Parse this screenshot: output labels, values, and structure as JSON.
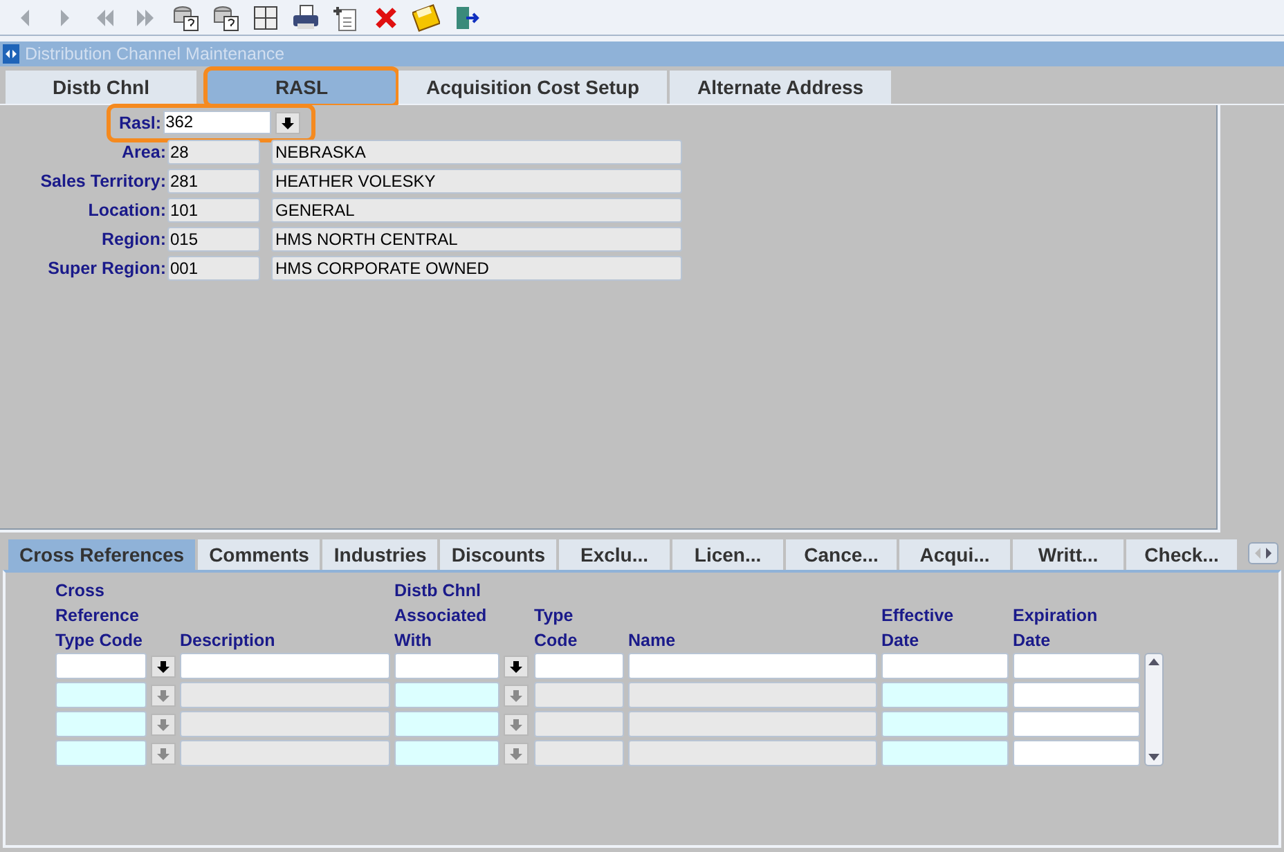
{
  "toolbar": [
    {
      "kind": "prev",
      "disabled": true
    },
    {
      "kind": "next",
      "disabled": true
    },
    {
      "kind": "first",
      "disabled": true
    },
    {
      "kind": "last",
      "disabled": true
    },
    {
      "kind": "query",
      "disabled": false
    },
    {
      "kind": "query-run",
      "disabled": false
    },
    {
      "kind": "count",
      "disabled": false
    },
    {
      "kind": "print",
      "disabled": false
    },
    {
      "kind": "new",
      "disabled": false
    },
    {
      "kind": "delete",
      "disabled": false
    },
    {
      "kind": "save",
      "disabled": false
    },
    {
      "kind": "exit",
      "disabled": false
    }
  ],
  "window": {
    "title": "Distribution Channel Maintenance"
  },
  "tabs": [
    {
      "label": "Distb Chnl",
      "selected": false,
      "highlighted": false
    },
    {
      "label": "RASL",
      "selected": true,
      "highlighted": true
    },
    {
      "label": "Acquisition Cost Setup",
      "selected": false,
      "highlighted": false
    },
    {
      "label": "Alternate Address",
      "selected": false,
      "highlighted": false
    }
  ],
  "rasl": {
    "label": "Rasl:",
    "value": "362",
    "highlighted": true
  },
  "fields": [
    {
      "label": "Area:",
      "code": "28",
      "name": "NEBRASKA"
    },
    {
      "label": "Sales Territory:",
      "code": "281",
      "name": "HEATHER VOLESKY"
    },
    {
      "label": "Location:",
      "code": "101",
      "name": "GENERAL"
    },
    {
      "label": "Region:",
      "code": "015",
      "name": "HMS NORTH CENTRAL"
    },
    {
      "label": "Super Region:",
      "code": "001",
      "name": "HMS CORPORATE OWNED"
    }
  ],
  "detail_tabs": [
    {
      "label": "Cross References",
      "selected": true
    },
    {
      "label": "Comments",
      "selected": false
    },
    {
      "label": "Industries",
      "selected": false
    },
    {
      "label": "Discounts",
      "selected": false
    },
    {
      "label": "Exclu...",
      "selected": false
    },
    {
      "label": "Licen...",
      "selected": false
    },
    {
      "label": "Cance...",
      "selected": false
    },
    {
      "label": "Acqui...",
      "selected": false
    },
    {
      "label": "Writt...",
      "selected": false
    },
    {
      "label": "Check...",
      "selected": false
    }
  ],
  "grid": {
    "columns": [
      {
        "kind": "field",
        "label": "Cross Reference Type Code"
      },
      {
        "kind": "lov"
      },
      {
        "kind": "field",
        "label": "Description"
      },
      {
        "kind": "field",
        "label": "Distb Chnl Associated With"
      },
      {
        "kind": "lov"
      },
      {
        "kind": "field",
        "label": "Type Code"
      },
      {
        "kind": "field",
        "label": "Name"
      },
      {
        "kind": "field",
        "label": "Effective Date"
      },
      {
        "kind": "field",
        "label": "Expiration Date"
      }
    ],
    "rows": [
      {
        "cells": [
          {
            "color": "#ffffff"
          },
          {
            "disabled": false
          },
          {
            "color": "#ffffff"
          },
          {
            "color": "#ffffff"
          },
          {
            "disabled": false
          },
          {
            "color": "#ffffff"
          },
          {
            "color": "#ffffff"
          },
          {
            "color": "#ffffff"
          },
          {
            "color": "#ffffff"
          }
        ]
      },
      {
        "cells": [
          {
            "color": "#dcffff"
          },
          {
            "disabled": true
          },
          {
            "color": "#e8e8e8"
          },
          {
            "color": "#dcffff"
          },
          {
            "disabled": true
          },
          {
            "color": "#e8e8e8"
          },
          {
            "color": "#e8e8e8"
          },
          {
            "color": "#dcffff"
          },
          {
            "color": "#ffffff"
          }
        ]
      },
      {
        "cells": [
          {
            "color": "#dcffff"
          },
          {
            "disabled": true
          },
          {
            "color": "#e8e8e8"
          },
          {
            "color": "#dcffff"
          },
          {
            "disabled": true
          },
          {
            "color": "#e8e8e8"
          },
          {
            "color": "#e8e8e8"
          },
          {
            "color": "#dcffff"
          },
          {
            "color": "#ffffff"
          }
        ]
      },
      {
        "cells": [
          {
            "color": "#dcffff"
          },
          {
            "disabled": true
          },
          {
            "color": "#e8e8e8"
          },
          {
            "color": "#dcffff"
          },
          {
            "disabled": true
          },
          {
            "color": "#e8e8e8"
          },
          {
            "color": "#e8e8e8"
          },
          {
            "color": "#dcffff"
          },
          {
            "color": "#ffffff"
          }
        ]
      }
    ]
  }
}
